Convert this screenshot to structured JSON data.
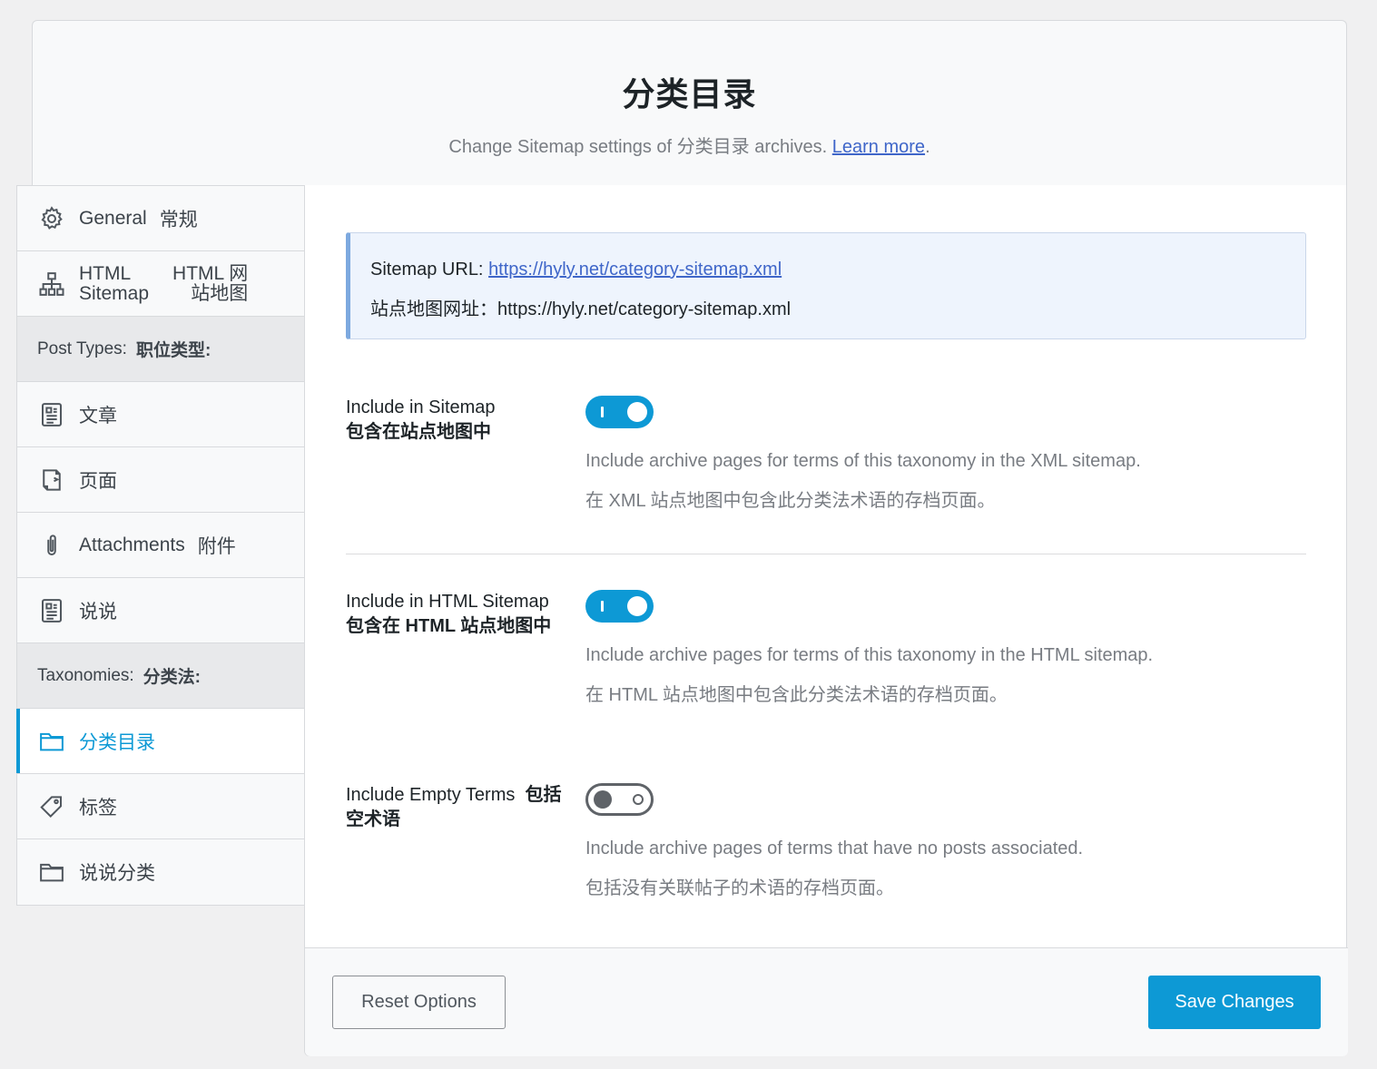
{
  "header": {
    "title": "分类目录",
    "subtitle_text": "Change Sitemap settings of 分类目录 archives. ",
    "learn_more": "Learn more",
    "subtitle_end": "."
  },
  "sidebar": {
    "general": {
      "en": "General",
      "zh": "常规"
    },
    "html_sitemap": {
      "en_1": "HTML",
      "en_2": "Sitemap",
      "zh_1": "HTML 网",
      "zh_2": "站地图"
    },
    "post_types_group": {
      "en": "Post Types:",
      "zh": "职位类型:"
    },
    "post": "文章",
    "page": "页面",
    "attachments": {
      "en": "Attachments",
      "zh": "附件"
    },
    "shuoshuo": "说说",
    "taxonomies_group": {
      "en": "Taxonomies:",
      "zh": "分类法:"
    },
    "category": "分类目录",
    "tags": "标签",
    "shuoshuo_category": "说说分类"
  },
  "info": {
    "label": "Sitemap URL: ",
    "url": "https://hyly.net/category-sitemap.xml",
    "zh_line": "站点地图网址：https://hyly.net/category-sitemap.xml"
  },
  "settings": [
    {
      "label_en": "Include in Sitemap",
      "label_zh": "包含在站点地图中",
      "enabled": true,
      "desc_en": "Include archive pages for terms of this taxonomy in the XML sitemap.",
      "desc_zh": "在 XML 站点地图中包含此分类法术语的存档页面。"
    },
    {
      "label_en": "Include in HTML Sitemap",
      "label_zh": "包含在 HTML 站点地图中",
      "enabled": true,
      "desc_en": "Include archive pages for terms of this taxonomy in the HTML sitemap.",
      "desc_zh": "在 HTML 站点地图中包含此分类法术语的存档页面。"
    },
    {
      "label_en": "Include Empty Terms",
      "label_zh": "包括空术语",
      "enabled": false,
      "desc_en": "Include archive pages of terms that have no posts associated.",
      "desc_zh": "包括没有关联帖子的术语的存档页面。"
    }
  ],
  "footer": {
    "reset_label": "Reset Options",
    "save_label": "Save Changes"
  },
  "colors": {
    "accent": "#0d99d5",
    "link": "#3f66c9",
    "info_border": "#7da9df"
  }
}
